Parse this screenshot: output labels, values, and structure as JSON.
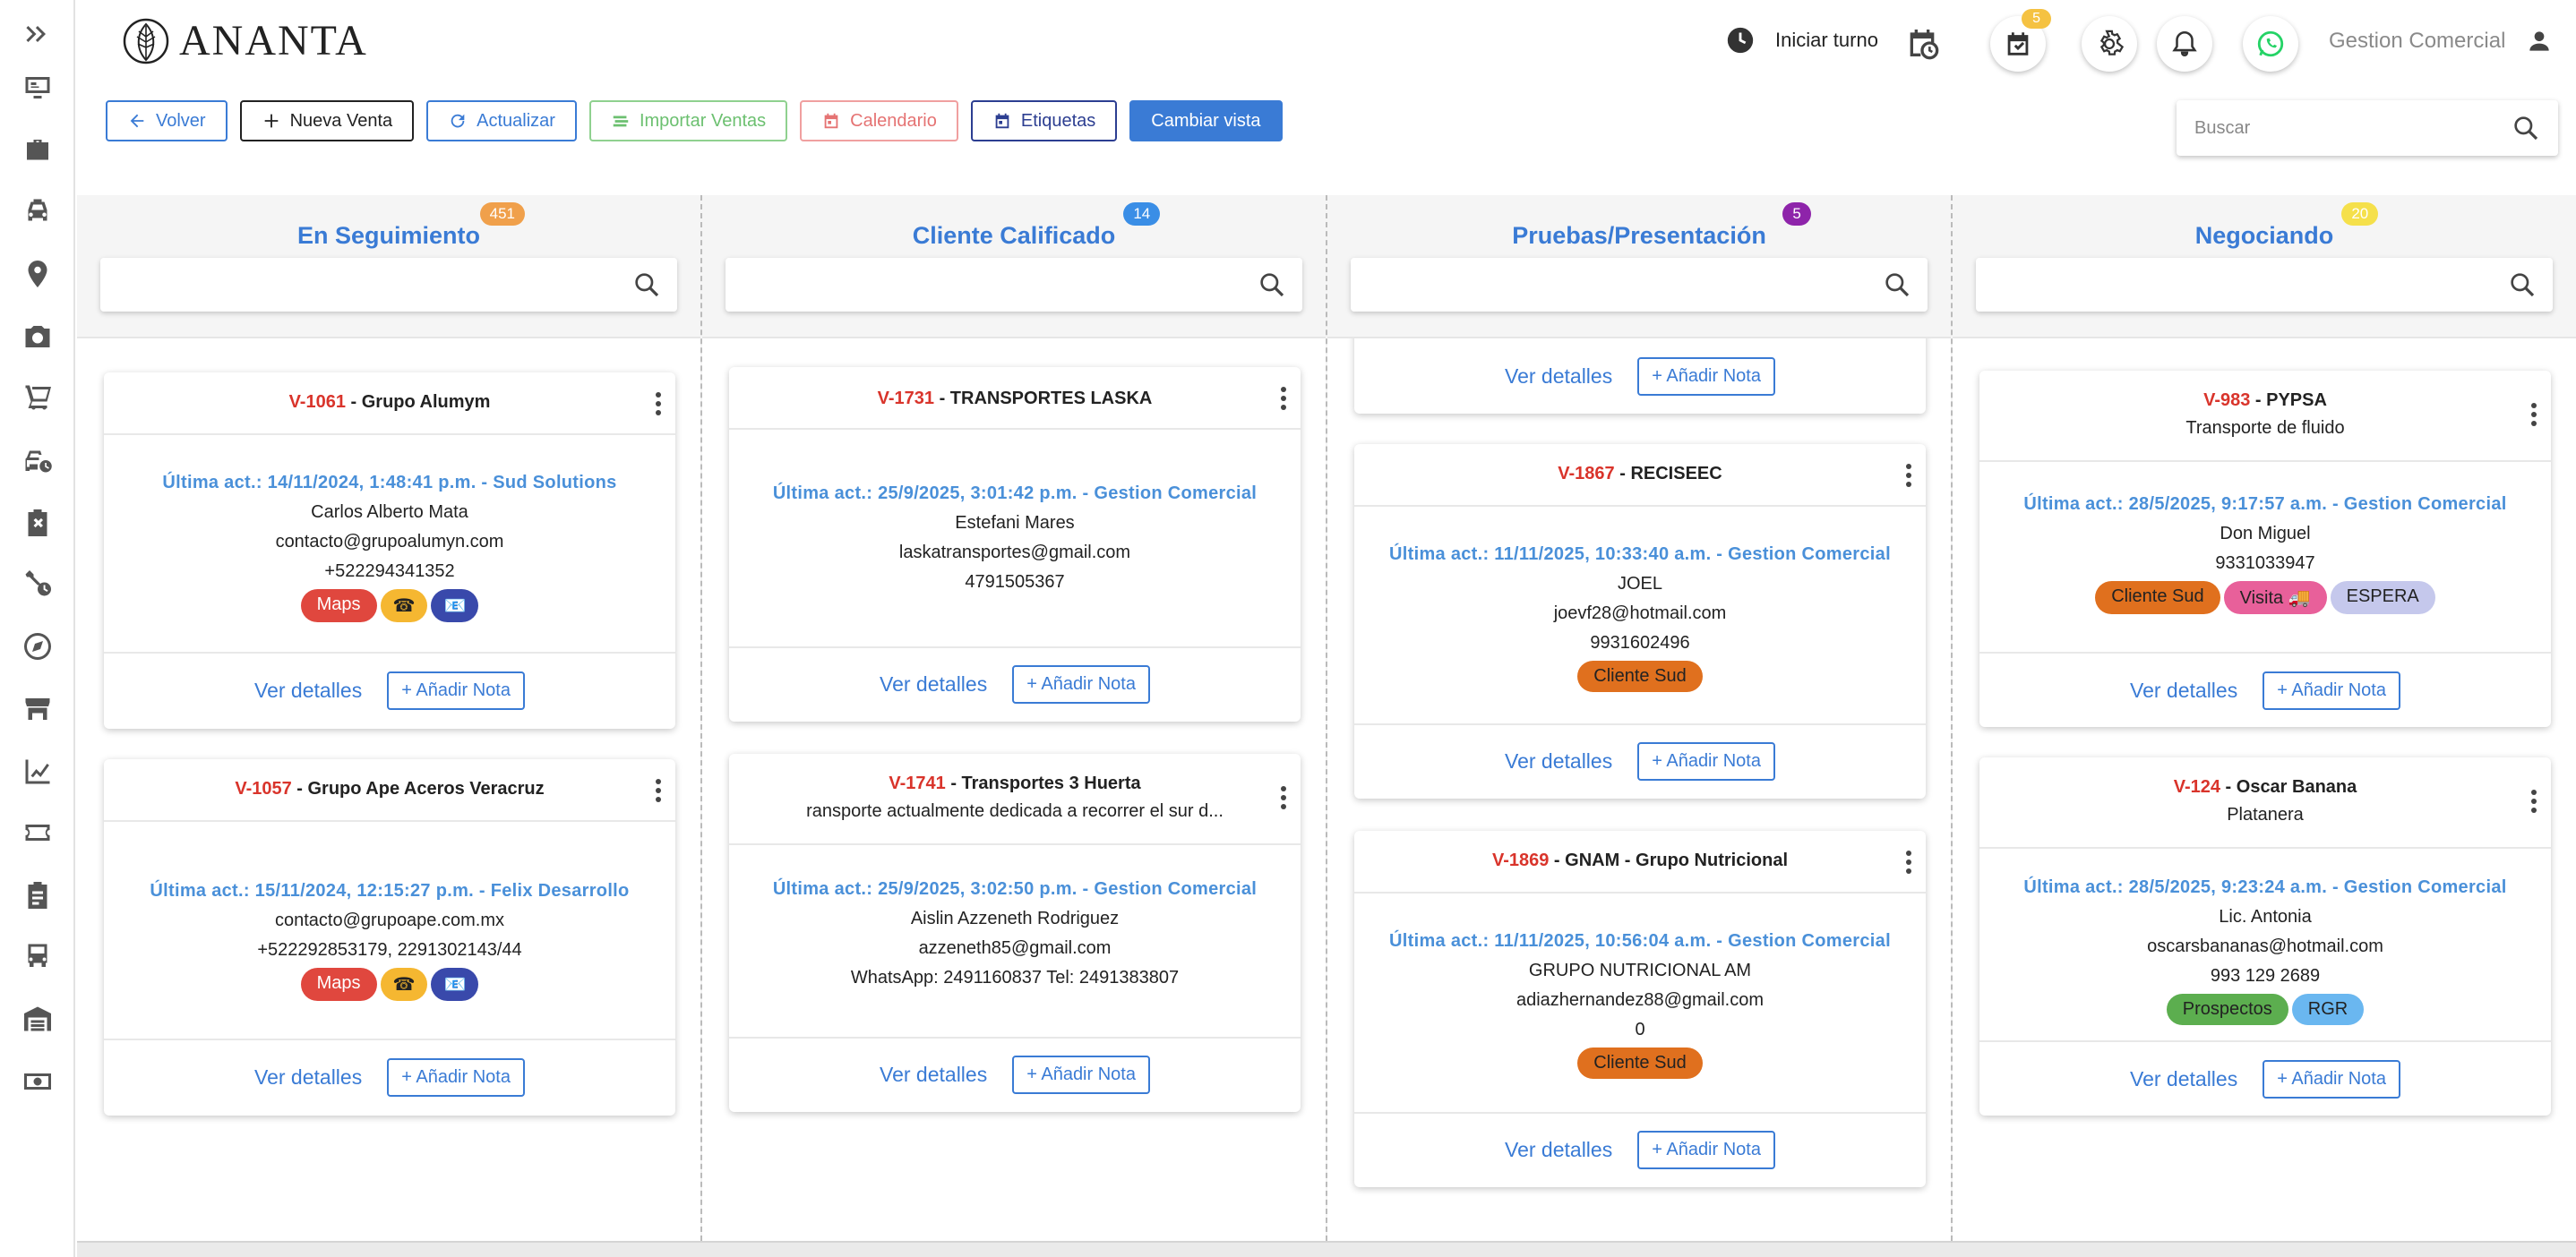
{
  "app": {
    "logo_text": "ANANTA"
  },
  "header": {
    "shift_label": "Iniciar turno",
    "tasks_badge": "5",
    "user_name": "Gestion Comercial"
  },
  "toolbar": {
    "back": "Volver",
    "new_sale": "Nueva Venta",
    "refresh": "Actualizar",
    "import_sales": "Importar Ventas",
    "calendar": "Calendario",
    "labels": "Etiquetas",
    "change_view": "Cambiar vista"
  },
  "search": {
    "placeholder": "Buscar"
  },
  "colors": {
    "primary": "#3a7bd5",
    "code_red": "#d9342b",
    "update_blue": "#4a90d9",
    "refresh_green": "#6cc070",
    "calendar_red": "#e57373",
    "labels_navy": "#2c3e91"
  },
  "columns": [
    {
      "title": "En Seguimiento",
      "count": "451",
      "count_color": "#f0a04b",
      "cards": [
        {
          "code": "V-1061",
          "name": " - Grupo Alumym",
          "subtitle": "",
          "updated": "Última act.: 14/11/2024, 1:48:41 p.m. - Sud Solutions",
          "lines": [
            "Carlos Alberto Mata",
            "contacto@grupoalumyn.com",
            "+522294341352"
          ],
          "tags": [
            {
              "label": "Maps",
              "color": "#e0473e"
            },
            {
              "label": "☎",
              "color": "#f5b731"
            },
            {
              "label": "📧",
              "color": "#3949ab"
            }
          ],
          "details": "Ver detalles",
          "add_note": "+ Añadir Nota"
        },
        {
          "code": "V-1057",
          "name": " - Grupo Ape Aceros Veracruz",
          "subtitle": "",
          "updated": "Última act.: 15/11/2024, 12:15:27 p.m. - Felix Desarrollo",
          "lines": [
            "contacto@grupoape.com.mx",
            "+522292853179, 2291302143/44"
          ],
          "tags": [
            {
              "label": "Maps",
              "color": "#e0473e"
            },
            {
              "label": "☎",
              "color": "#f5b731"
            },
            {
              "label": "📧",
              "color": "#3949ab"
            }
          ],
          "details": "Ver detalles",
          "add_note": "+ Añadir Nota"
        }
      ]
    },
    {
      "title": "Cliente Calificado",
      "count": "14",
      "count_color": "#3a8ee6",
      "cards": [
        {
          "code": "V-1731",
          "name": " - TRANSPORTES LASKA",
          "subtitle": "",
          "updated": "Última act.: 25/9/2025, 3:01:42 p.m. - Gestion Comercial",
          "lines": [
            "Estefani Mares",
            "laskatransportes@gmail.com",
            "4791505367"
          ],
          "tags": [],
          "details": "Ver detalles",
          "add_note": "+ Añadir Nota"
        },
        {
          "code": "V-1741",
          "name": " - Transportes 3 Huerta",
          "subtitle": "ransporte actualmente dedicada a recorrer el sur d...",
          "updated": "Última act.: 25/9/2025, 3:02:50 p.m. - Gestion Comercial",
          "lines": [
            "Aislin Azzeneth Rodriguez",
            "azzeneth85@gmail.com",
            "WhatsApp: 2491160837 Tel: 2491383807"
          ],
          "tags": [],
          "details": "Ver detalles",
          "add_note": "+ Añadir Nota"
        }
      ]
    },
    {
      "title": "Pruebas/Presentación",
      "count": "5",
      "count_color": "#8e24aa",
      "partial_card": {
        "details": "Ver detalles",
        "add_note": "+ Añadir Nota"
      },
      "cards": [
        {
          "code": "V-1867",
          "name": " - RECISEEC",
          "subtitle": "",
          "updated": "Última act.: 11/11/2025, 10:33:40 a.m. - Gestion Comercial",
          "lines": [
            "JOEL",
            "joevf28@hotmail.com",
            "9931602496"
          ],
          "tags": [
            {
              "label": "Cliente Sud",
              "color": "#e0701e",
              "dark": true
            }
          ],
          "details": "Ver detalles",
          "add_note": "+ Añadir Nota"
        },
        {
          "code": "V-1869",
          "name": " - GNAM - Grupo Nutricional",
          "subtitle": "",
          "updated": "Última act.: 11/11/2025, 10:56:04 a.m. - Gestion Comercial",
          "lines": [
            "GRUPO NUTRICIONAL AM",
            "adiazhernandez88@gmail.com",
            "0"
          ],
          "tags": [
            {
              "label": "Cliente Sud",
              "color": "#e0701e",
              "dark": true
            }
          ],
          "details": "Ver detalles",
          "add_note": "+ Añadir Nota"
        }
      ]
    },
    {
      "title": "Negociando",
      "count": "20",
      "count_color": "#f5e04b",
      "cards": [
        {
          "code": "V-983",
          "name": " - PYPSA",
          "subtitle": "Transporte de fluido",
          "updated": "Última act.: 28/5/2025, 9:17:57 a.m. - Gestion Comercial",
          "lines": [
            "Don Miguel",
            "9331033947"
          ],
          "tags": [
            {
              "label": "Cliente Sud",
              "color": "#e0701e",
              "dark": true
            },
            {
              "label": "Visita 🚚",
              "color": "#e8609a",
              "dark": true
            },
            {
              "label": "ESPERA",
              "color": "#c5c8ec",
              "dark": true
            }
          ],
          "details": "Ver detalles",
          "add_note": "+ Añadir Nota"
        },
        {
          "code": "V-124",
          "name": " - Oscar Banana",
          "subtitle": "Platanera",
          "updated": "Última act.: 28/5/2025, 9:23:24 a.m. - Gestion Comercial",
          "lines": [
            "Lic. Antonia",
            "oscarsbananas@hotmail.com",
            "993 129 2689"
          ],
          "tags": [
            {
              "label": "Prospectos",
              "color": "#5cae4f",
              "dark": true
            },
            {
              "label": "RGR",
              "color": "#6ab7f0",
              "dark": true
            }
          ],
          "details": "Ver detalles",
          "add_note": "+ Añadir Nota"
        }
      ]
    }
  ]
}
